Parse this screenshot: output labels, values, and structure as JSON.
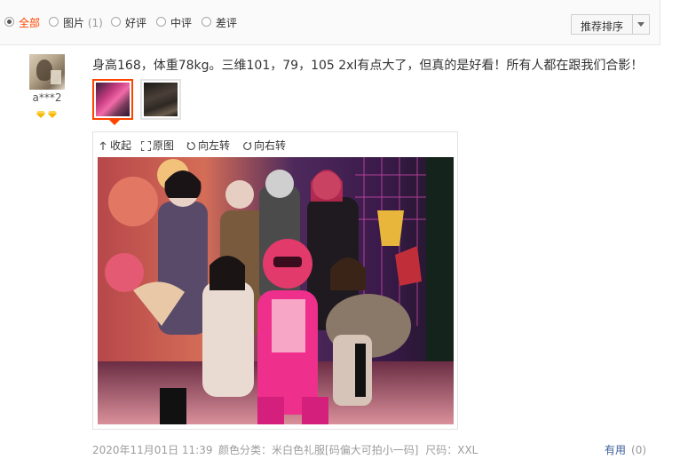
{
  "filters": [
    {
      "label": "全部",
      "count": "",
      "checked": true
    },
    {
      "label": "图片",
      "count": "(1)",
      "checked": false
    },
    {
      "label": "好评",
      "count": "",
      "checked": false
    },
    {
      "label": "中评",
      "count": "",
      "checked": false
    },
    {
      "label": "差评",
      "count": "",
      "checked": false
    }
  ],
  "sort": {
    "label": "推荐排序"
  },
  "reviewer": {
    "name": "a***2",
    "badge_icon": "diamond-icon",
    "badge_color": "#f5b800"
  },
  "review": {
    "text": "身高168，体重78kg。三维101，79，105 2xl有点大了，但真的是好看！所有人都在跟我们合影！",
    "thumbnails": 2,
    "selected_thumbnail": 0
  },
  "viewer": {
    "collapse": "收起",
    "original": "原图",
    "rotate_left": "向左转",
    "rotate_right": "向右转"
  },
  "footer": {
    "date": "2020年11月01日 11:39",
    "attr1_label": "颜色分类：",
    "attr1_value": "米白色礼服[码偏大可拍小一码]",
    "attr2_label": "尺码：",
    "attr2_value": "XXL",
    "useful_label": "有用",
    "useful_count": "(0)"
  },
  "colors": {
    "accent": "#ff4400",
    "link": "#3c5e9b"
  }
}
